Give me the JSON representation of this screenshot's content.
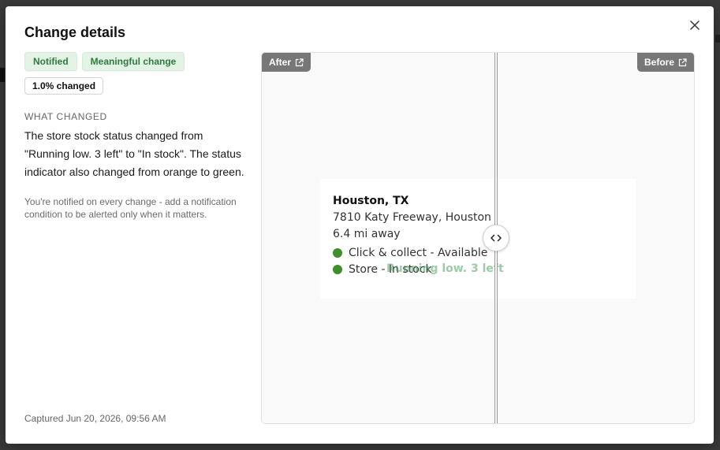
{
  "modal": {
    "title": "Change details",
    "close_label": "×"
  },
  "badges": {
    "notified": "Notified",
    "meaningful": "Meaningful change",
    "percent_changed": "1.0% changed"
  },
  "what_changed": {
    "label": "WHAT CHANGED",
    "description": "The store stock status changed from \"Running low. 3 left\" to \"In stock\". The status indicator also changed from orange to green.",
    "note": "You're notified on every change - add a notification condition to be alerted only when it matters."
  },
  "captured": "Captured Jun 20, 2026, 09:56 AM",
  "compare": {
    "after_label": "After",
    "before_label": "Before",
    "handle_icon": "arrows-left-right-icon",
    "card": {
      "store_name": "Houston, TX",
      "address": "7810 Katy Freeway, Houston",
      "distance": "6.4 mi away",
      "rows": [
        {
          "label": "Click & collect - Available"
        },
        {
          "label": "Store - In stock",
          "ghost": "Running low. 3 left"
        }
      ]
    }
  },
  "colors": {
    "badge_green_bg": "#e3f3e6",
    "badge_green_text": "#2f7a3c",
    "status_dot": "#3f8f2a",
    "tag_bg": "#777777"
  }
}
